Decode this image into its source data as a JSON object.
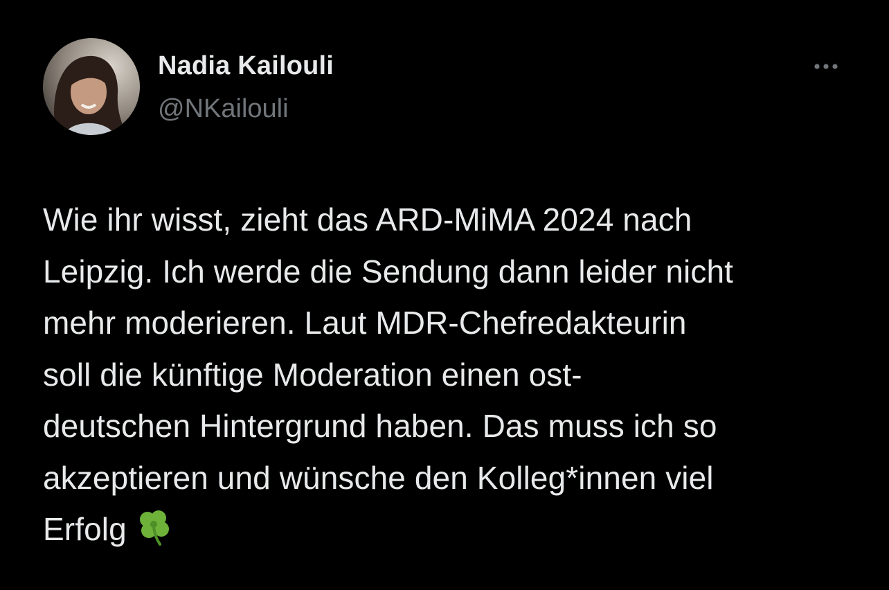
{
  "author": {
    "display_name": "Nadia Kailouli",
    "handle": "@NKailouli",
    "avatar_icon": "profile-photo"
  },
  "menu": {
    "icon": "more-horizontal-icon"
  },
  "tweet": {
    "text": "Wie ihr wisst, zieht das ARD-MiMA 2024 nach\nLeipzig. Ich werde die Sendung dann leider nicht\nmehr moderieren. Laut MDR-Chefredakteurin\nsoll die künftige Moderation einen ost-\ndeutschen Hintergrund haben. Das muss ich so\nakzeptieren und wünsche den Kolleg*innen viel\nErfolg",
    "emoji": "four-leaf-clover"
  },
  "colors": {
    "background": "#000000",
    "primary_text": "#e7e9ea",
    "secondary_text": "#71767b",
    "clover_green": "#6fb23a"
  }
}
